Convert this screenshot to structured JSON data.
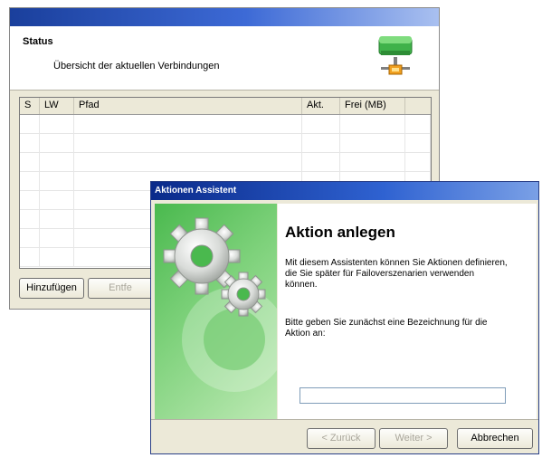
{
  "status_window": {
    "title": "Status",
    "subtitle": "Übersicht der aktuellen Verbindungen",
    "icon": "network-drive-icon",
    "table": {
      "columns": [
        "S",
        "LW",
        "Pfad",
        "Akt.",
        "Frei (MB)",
        ""
      ],
      "rows": []
    },
    "buttons": {
      "add": "Hinzufügen",
      "remove": "Entfe"
    }
  },
  "wizard": {
    "title": "Aktionen Assistent",
    "heading": "Aktion anlegen",
    "description": "Mit diesem Assistenten können Sie Aktionen definieren, die Sie später für Failoverszenarien verwenden können.",
    "prompt": "Bitte geben Sie zunächst eine Bezeichnung für die Aktion an:",
    "name_input": {
      "value": ""
    },
    "side_image": "gears-illustration",
    "buttons": {
      "back": "< Zurück",
      "next": "Weiter >",
      "cancel": "Abbrechen"
    }
  },
  "colors": {
    "title_bar": "#0a2a8a",
    "window_bg": "#ece9d8",
    "wizard_green": "#4ab94e"
  }
}
